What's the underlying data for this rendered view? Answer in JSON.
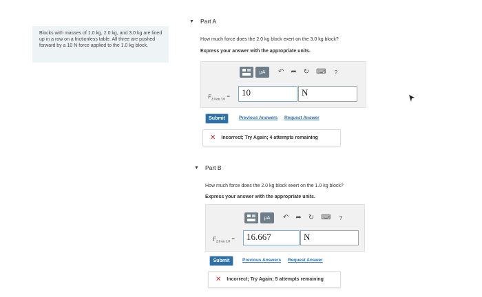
{
  "problem": {
    "text": "Blocks with masses of 1.0 kg, 2.0 kg, and 3.0 kg are lined up in a row on a frictionless table. All three are pushed forward by a 10 N force applied to the 1.0 kg block."
  },
  "toolbar": {
    "template_icon": "template-icon",
    "mu_label": "μA",
    "undo_icon": "undo-icon",
    "redo_icon": "redo-icon",
    "reset_icon": "reset-icon",
    "keyboard_icon": "keyboard-icon",
    "help_label": "?"
  },
  "parts": [
    {
      "title": "Part A",
      "question": "How much force does the 2.0 kg block exert on the 3.0 kg block?",
      "instruction": "Express your answer with the appropriate units.",
      "var_symbol": "F",
      "var_subscript": "2.0 on 3.0",
      "equals": "=",
      "value": "10",
      "unit": "N",
      "submit_label": "Submit",
      "previous_answers": "Previous Answers",
      "request_answer": "Request Answer",
      "feedback": "Incorrect; Try Again; 4 attempts remaining"
    },
    {
      "title": "Part B",
      "question": "How much force does the 2.0 kg block exert on the 1.0 kg block?",
      "instruction": "Express your answer with the appropriate units.",
      "var_symbol": "F",
      "var_subscript": "2.0 on 1.0",
      "equals": "=",
      "value": "16.667",
      "unit": "N",
      "submit_label": "Submit",
      "previous_answers": "Previous Answers",
      "request_answer": "Request Answer",
      "feedback": "Incorrect; Try Again; 5 attempts remaining"
    }
  ],
  "colors": {
    "accent": "#2e71a8",
    "error": "#c6282c",
    "panel": "#f1f1f1",
    "problem_bg": "#eef3f6"
  }
}
